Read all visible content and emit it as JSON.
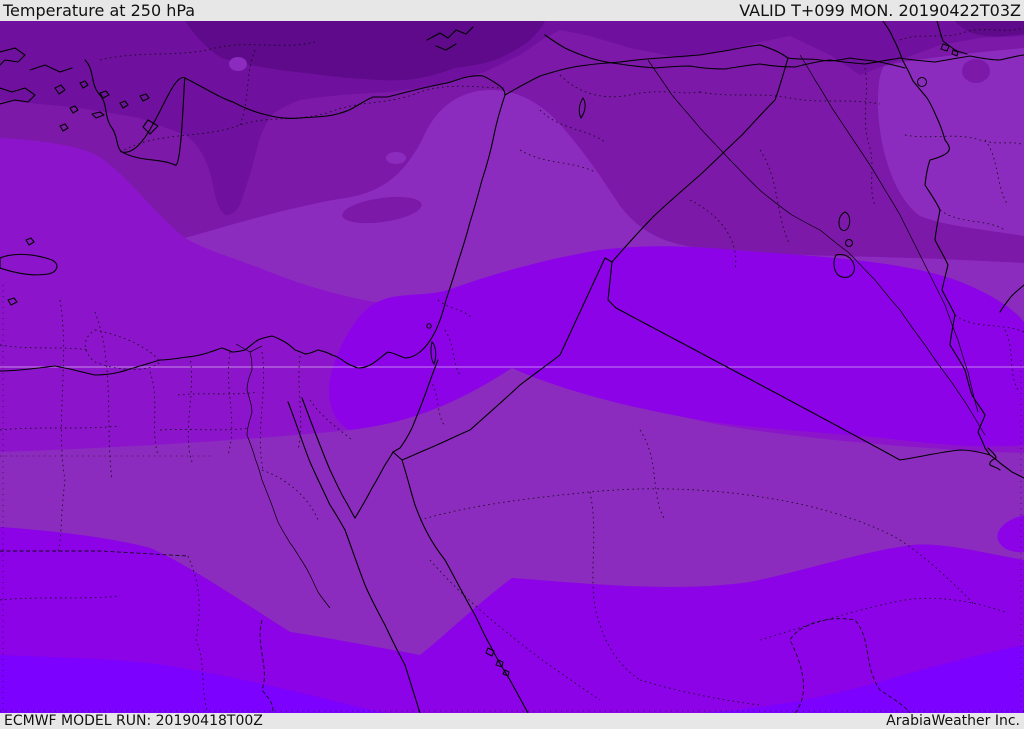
{
  "header": {
    "title": "Temperature at 250 hPa",
    "valid_label": "VALID T+099 MON. 20190422T03Z"
  },
  "footer": {
    "model_run_label": "ECMWF MODEL RUN: 20190418T00Z",
    "provider_label": "ArabiaWeather Inc."
  },
  "map": {
    "parameter": "Temperature",
    "level": "250 hPa",
    "model": "ECMWF",
    "palette": {
      "band_coldest": "#5e0a8a",
      "band_cold": "#6f119e",
      "band_cool": "#7c19a9",
      "band_mild": "#8c2cbe",
      "band_general": "#8c15cc",
      "band_warm": "#8b03e6",
      "band_warmest": "#7d01fe"
    },
    "shading_bands": [
      {
        "position": "north (coldest)",
        "color": "#5e0a8a"
      },
      {
        "position": "north band",
        "color": "#6f119e"
      },
      {
        "position": "upper mid (Turkey)",
        "color": "#7c19a9"
      },
      {
        "position": "mid dull band",
        "color": "#8c2cbe"
      },
      {
        "position": "general area",
        "color": "#8c15cc"
      },
      {
        "position": "warm core (Levant/Arabia)",
        "color": "#8b03e6"
      },
      {
        "position": "south (warmest)",
        "color": "#7d01fe"
      }
    ],
    "line_colors": {
      "coastline_border": "#000000",
      "graticule": "rgba(255,255,255,0.5)"
    },
    "ui": {
      "header_background": "#e7e7e7",
      "text_color": "#111111"
    }
  }
}
